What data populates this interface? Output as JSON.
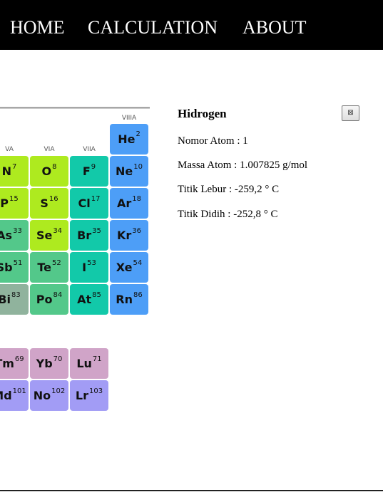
{
  "nav": {
    "home": "HOME",
    "calculation": "CALCULATION",
    "about": "ABOUT"
  },
  "table": {
    "group_labels": [
      "VA",
      "VIA",
      "VIIA",
      "VIIIA"
    ],
    "rows": [
      [
        {
          "symbol": "He",
          "number": "2",
          "color": "#4d9ef7"
        }
      ],
      [
        {
          "symbol": "N",
          "number": "7",
          "color": "#aeea1f"
        },
        {
          "symbol": "O",
          "number": "8",
          "color": "#aeea1f"
        },
        {
          "symbol": "F",
          "number": "9",
          "color": "#12c9a9"
        },
        {
          "symbol": "Ne",
          "number": "10",
          "color": "#4d9ef7"
        }
      ],
      [
        {
          "symbol": "P",
          "number": "15",
          "color": "#aeea1f"
        },
        {
          "symbol": "S",
          "number": "16",
          "color": "#aeea1f"
        },
        {
          "symbol": "Cl",
          "number": "17",
          "color": "#12c9a9"
        },
        {
          "symbol": "Ar",
          "number": "18",
          "color": "#4d9ef7"
        }
      ],
      [
        {
          "symbol": "As",
          "number": "33",
          "color": "#53c88a"
        },
        {
          "symbol": "Se",
          "number": "34",
          "color": "#aeea1f"
        },
        {
          "symbol": "Br",
          "number": "35",
          "color": "#12c9a9"
        },
        {
          "symbol": "Kr",
          "number": "36",
          "color": "#4d9ef7"
        }
      ],
      [
        {
          "symbol": "Sb",
          "number": "51",
          "color": "#53c88a"
        },
        {
          "symbol": "Te",
          "number": "52",
          "color": "#53c88a"
        },
        {
          "symbol": "I",
          "number": "53",
          "color": "#12c9a9"
        },
        {
          "symbol": "Xe",
          "number": "54",
          "color": "#4d9ef7"
        }
      ],
      [
        {
          "symbol": "Bi",
          "number": "83",
          "color": "#90b39d"
        },
        {
          "symbol": "Po",
          "number": "84",
          "color": "#53c88a"
        },
        {
          "symbol": "At",
          "number": "85",
          "color": "#12c9a9"
        },
        {
          "symbol": "Rn",
          "number": "86",
          "color": "#4d9ef7"
        }
      ],
      [
        {
          "symbol": "Tm",
          "number": "69",
          "color": "#d0a4c8"
        },
        {
          "symbol": "Yb",
          "number": "70",
          "color": "#d0a4c8"
        },
        {
          "symbol": "Lu",
          "number": "71",
          "color": "#d0a4c8"
        }
      ],
      [
        {
          "symbol": "Md",
          "number": "101",
          "color": "#a29cf5"
        },
        {
          "symbol": "No",
          "number": "102",
          "color": "#a29cf5"
        },
        {
          "symbol": "Lr",
          "number": "103",
          "color": "#a29cf5"
        }
      ]
    ]
  },
  "detail": {
    "title": "Hidrogen",
    "close_icon": "close-icon",
    "atomic_number": "Nomor Atom : 1",
    "atomic_mass": "Massa Atom : 1.007825 g/mol",
    "melting_point": "Titik Lebur : -259,2 ° C",
    "boiling_point": "Titik Didih : -252,8 ° C"
  }
}
